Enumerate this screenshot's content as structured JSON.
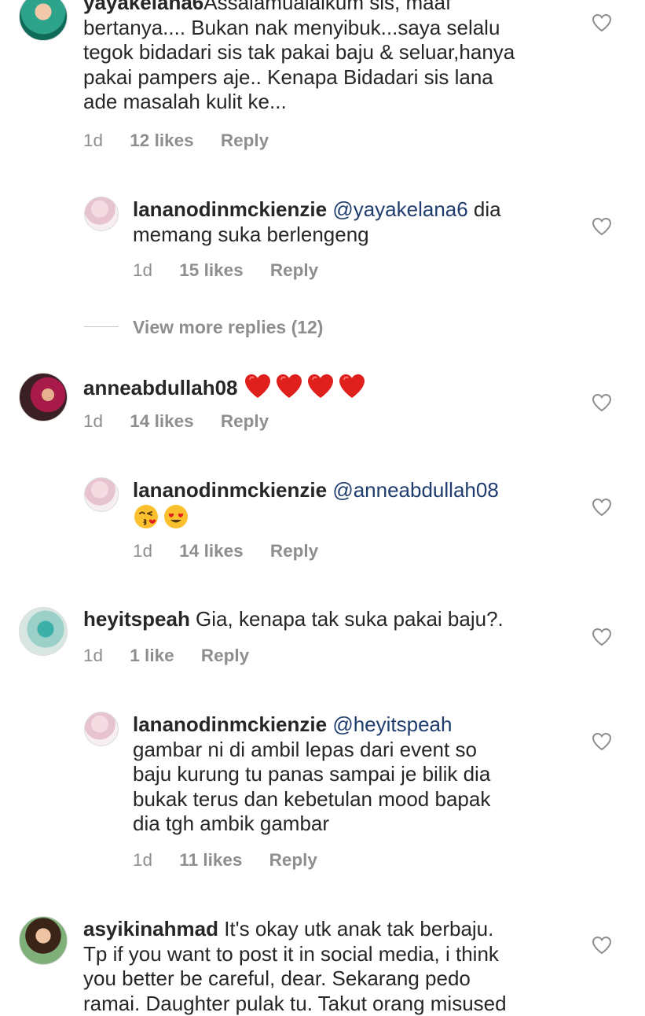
{
  "comments": [
    {
      "username": "yayakelana6",
      "text": " Assalamualaikum  sis, maaf bertanya.... Bukan nak menyibuk...saya selalu tegok bidadari sis tak pakai baju & seluar,hanya pakai pampers aje.. Kenapa Bidadari sis lana ade masalah kulit ke...",
      "lines": [
        "Assalamualaikum  sis, maaf",
        "bertanya.... Bukan nak menyibuk...saya selalu",
        "tegok bidadari sis tak pakai baju & seluar,hanya",
        "pakai pampers aje.. Kenapa Bidadari sis lana",
        "ade masalah kulit ke..."
      ],
      "time": "1d",
      "likes": "12 likes",
      "reply": "Reply",
      "replies": [
        {
          "username": "lananodinmckienzie",
          "mention": "@yayakelana6",
          "lines": [
            " dia",
            "memang suka berlengeng"
          ],
          "time": "1d",
          "likes": "15 likes",
          "reply": "Reply"
        }
      ],
      "view_more": "View more replies (12)"
    },
    {
      "username": "anneabdullah08",
      "time": "1d",
      "likes": "14 likes",
      "reply": "Reply",
      "replies": [
        {
          "username": "lananodinmckienzie",
          "mention": "@anneabdullah08",
          "time": "1d",
          "likes": "14 likes",
          "reply": "Reply"
        }
      ]
    },
    {
      "username": "heyitspeah",
      "text": " Gia, kenapa tak suka pakai baju?.",
      "time": "1d",
      "likes": "1 like",
      "reply": "Reply",
      "replies": [
        {
          "username": "lananodinmckienzie",
          "mention": "@heyitspeah",
          "lines": [
            "gambar ni di ambil lepas dari event so",
            "baju kurung tu panas sampai je bilik dia",
            "bukak terus dan kebetulan mood bapak",
            "dia tgh ambik gambar"
          ],
          "time": "1d",
          "likes": "11 likes",
          "reply": "Reply"
        }
      ]
    },
    {
      "username": "asyikinahmad",
      "lines": [
        " It's okay utk anak tak berbaju.",
        "Tp if you want to post it in social media, i think",
        "you better be careful, dear. Sekarang pedo",
        "ramai. Daughter pulak tu. Takut orang misused"
      ]
    }
  ],
  "colors": {
    "mention": "#1f3c6e",
    "meta": "#8e8e8e",
    "heart_emoji": "#e0201d"
  },
  "icons": {
    "like": "heart-outline-icon"
  }
}
